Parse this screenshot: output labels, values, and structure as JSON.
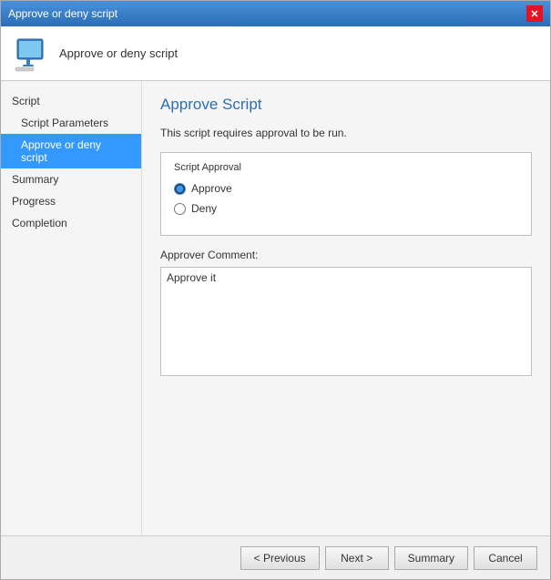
{
  "window": {
    "title": "Approve or deny script",
    "close_btn_label": "✕"
  },
  "header": {
    "icon_alt": "computer-icon",
    "text": "Approve or deny script"
  },
  "sidebar": {
    "items": [
      {
        "id": "script",
        "label": "Script",
        "type": "section-header",
        "active": false,
        "disabled": false
      },
      {
        "id": "script-parameters",
        "label": "Script Parameters",
        "type": "sub-item",
        "active": false,
        "disabled": false
      },
      {
        "id": "approve-deny-script",
        "label": "Approve or deny script",
        "type": "sub-item",
        "active": true,
        "disabled": false
      },
      {
        "id": "summary",
        "label": "Summary",
        "type": "section-header",
        "active": false,
        "disabled": false
      },
      {
        "id": "progress",
        "label": "Progress",
        "type": "section-header",
        "active": false,
        "disabled": true
      },
      {
        "id": "completion",
        "label": "Completion",
        "type": "section-header",
        "active": false,
        "disabled": true
      }
    ]
  },
  "main": {
    "page_title": "Approve Script",
    "description": "This script requires approval to be run.",
    "group_box_label": "Script Approval",
    "radio_approve_label": "Approve",
    "radio_deny_label": "Deny",
    "comment_label": "Approver Comment:",
    "comment_value": "Approve it"
  },
  "footer": {
    "previous_label": "< Previous",
    "next_label": "Next >",
    "summary_label": "Summary",
    "cancel_label": "Cancel"
  }
}
